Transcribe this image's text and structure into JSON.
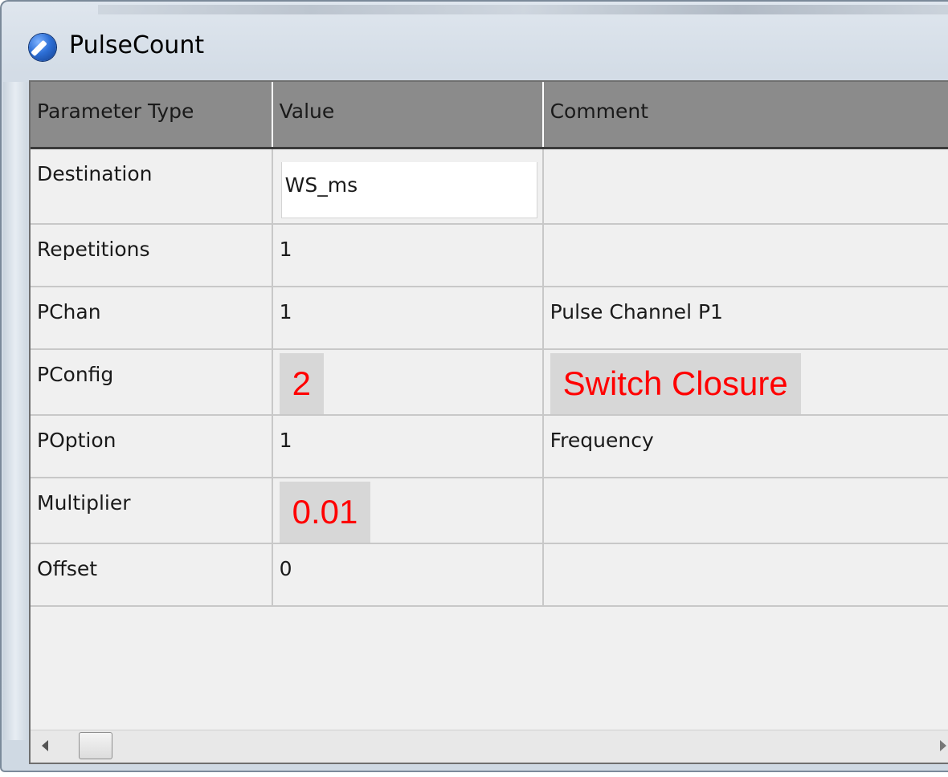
{
  "window": {
    "title": "PulseCount"
  },
  "table": {
    "columns": [
      "Parameter Type",
      "Value",
      "Comment"
    ],
    "rows": [
      {
        "type": "Destination",
        "value": "WS_ms",
        "comment": ""
      },
      {
        "type": "Repetitions",
        "value": "1",
        "comment": ""
      },
      {
        "type": "PChan",
        "value": "1",
        "comment": "Pulse Channel P1"
      },
      {
        "type": "PConfig",
        "value": "2",
        "comment": "Switch Closure"
      },
      {
        "type": "POption",
        "value": "1",
        "comment": "Frequency"
      },
      {
        "type": "Multiplier",
        "value": "0.01",
        "comment": ""
      },
      {
        "type": "Offset",
        "value": "0",
        "comment": ""
      }
    ]
  },
  "colors": {
    "highlight_text": "#ff0000",
    "header_bg": "#8b8b8b"
  }
}
